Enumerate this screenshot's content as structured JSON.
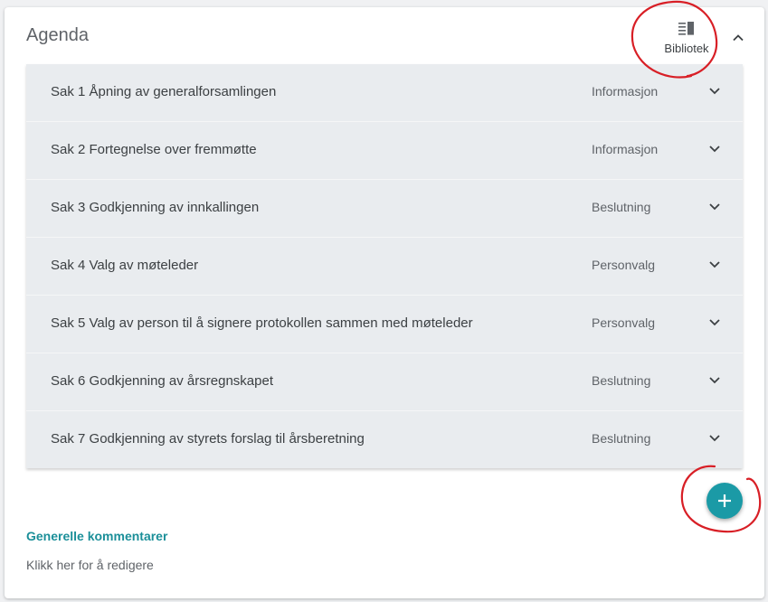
{
  "agenda": {
    "title": "Agenda",
    "library_label": "Bibliotek",
    "library_icon": "library-icon",
    "collapse_icon": "chevron-up-icon",
    "items": [
      {
        "title": "Sak 1 Åpning av generalforsamlingen",
        "type": "Informasjon"
      },
      {
        "title": "Sak 2 Fortegnelse over fremmøtte",
        "type": "Informasjon"
      },
      {
        "title": "Sak 3 Godkjenning av innkallingen",
        "type": "Beslutning"
      },
      {
        "title": "Sak 4 Valg av møteleder",
        "type": "Personvalg"
      },
      {
        "title": "Sak 5 Valg av person til å signere protokollen sammen med møteleder",
        "type": "Personvalg"
      },
      {
        "title": "Sak 6 Godkjenning av årsregnskapet",
        "type": "Beslutning"
      },
      {
        "title": "Sak 7 Godkjenning av styrets forslag til årsberetning",
        "type": "Beslutning"
      }
    ],
    "add_icon": "plus-icon"
  },
  "comments": {
    "title": "Generelle kommentarer",
    "placeholder": "Klikk her for å redigere"
  },
  "colors": {
    "accent": "#1b9aa6",
    "annotation": "#d81f26",
    "row_bg": "#e9ecef"
  }
}
